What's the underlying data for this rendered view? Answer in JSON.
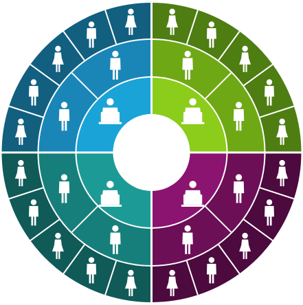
{
  "diagram": {
    "type": "concentric-organization-wheel",
    "quadrants": [
      {
        "name": "top-left",
        "center_icon": "manager-laptop-icon",
        "colors": {
          "inner": "#1aa3d6",
          "middle": "#1a86b8",
          "outer": "#125f80"
        },
        "middle_icons": [
          "man-icon",
          "man-icon"
        ],
        "outer_icons": [
          "woman-icon",
          "man-icon",
          "woman-icon",
          "man-icon",
          "woman-icon"
        ]
      },
      {
        "name": "top-right",
        "center_icon": "manager-laptop-icon",
        "colors": {
          "inner": "#8ccc1a",
          "middle": "#6fa815",
          "outer": "#4e7d12"
        },
        "middle_icons": [
          "man-icon",
          "man-icon"
        ],
        "outer_icons": [
          "woman-icon",
          "man-icon",
          "woman-icon",
          "man-icon",
          "woman-icon"
        ]
      },
      {
        "name": "bottom-right",
        "center_icon": "manager-laptop-icon",
        "colors": {
          "inner": "#8a1470",
          "middle": "#6c0f57",
          "outer": "#4c0a3e"
        },
        "middle_icons": [
          "man-icon",
          "man-icon"
        ],
        "outer_icons": [
          "woman-icon",
          "man-icon",
          "woman-icon",
          "man-icon",
          "woman-icon"
        ]
      },
      {
        "name": "bottom-left",
        "center_icon": "manager-laptop-icon",
        "colors": {
          "inner": "#1c9a96",
          "middle": "#177f7b",
          "outer": "#105a57"
        },
        "middle_icons": [
          "man-icon",
          "man-icon"
        ],
        "outer_icons": [
          "woman-icon",
          "man-icon",
          "woman-icon",
          "man-icon",
          "woman-icon"
        ]
      }
    ],
    "divider_color": "#ffffff",
    "hub_color": "#ffffff"
  }
}
